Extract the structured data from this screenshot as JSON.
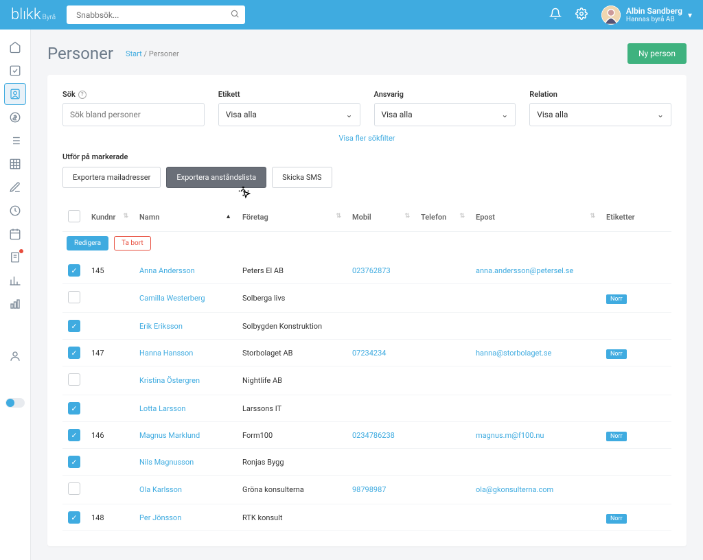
{
  "topbar": {
    "logo_main": "blıkk",
    "logo_sub": "Byrå",
    "search_placeholder": "Snabbsök...",
    "user_name": "Albin Sandberg",
    "user_org": "Hannas byrå AB"
  },
  "page": {
    "title": "Personer",
    "crumb_start": "Start",
    "crumb_sep": " / ",
    "crumb_current": "Personer",
    "new_btn": "Ny person"
  },
  "filters": {
    "sok_label": "Sök",
    "sok_placeholder": "Sök bland personer",
    "etikett_label": "Etikett",
    "etikett_value": "Visa alla",
    "ansvarig_label": "Ansvarig",
    "ansvarig_value": "Visa alla",
    "relation_label": "Relation",
    "relation_value": "Visa alla",
    "more_link": "Visa fler sökfilter"
  },
  "actions": {
    "label": "Utför på markerade",
    "export_email": "Exportera mailadresser",
    "export_anstand": "Exportera anståndslista",
    "send_sms": "Skicka SMS"
  },
  "row_actions": {
    "edit": "Redigera",
    "delete": "Ta bort"
  },
  "columns": {
    "kundnr": "Kundnr",
    "namn": "Namn",
    "foretag": "Företag",
    "mobil": "Mobil",
    "telefon": "Telefon",
    "epost": "Epost",
    "etiketter": "Etiketter"
  },
  "rows": [
    {
      "checked": true,
      "kundnr": "145",
      "namn": "Anna Andersson",
      "foretag": "Peters El AB",
      "mobil": "023762873",
      "telefon": "",
      "epost": "anna.andersson@petersel.se",
      "etikett": ""
    },
    {
      "checked": false,
      "kundnr": "",
      "namn": "Camilla Westerberg",
      "foretag": "Solberga livs",
      "mobil": "",
      "telefon": "",
      "epost": "",
      "etikett": "Norr"
    },
    {
      "checked": true,
      "kundnr": "",
      "namn": "Erik Eriksson",
      "foretag": "Solbygden Konstruktion",
      "mobil": "",
      "telefon": "",
      "epost": "",
      "etikett": ""
    },
    {
      "checked": true,
      "kundnr": "147",
      "namn": "Hanna Hansson",
      "foretag": "Storbolaget AB",
      "mobil": "07234234",
      "telefon": "",
      "epost": "hanna@storbolaget.se",
      "etikett": "Norr"
    },
    {
      "checked": false,
      "kundnr": "",
      "namn": "Kristina Östergren",
      "foretag": "Nightlife AB",
      "mobil": "",
      "telefon": "",
      "epost": "",
      "etikett": ""
    },
    {
      "checked": true,
      "kundnr": "",
      "namn": "Lotta Larsson",
      "foretag": "Larssons IT",
      "mobil": "",
      "telefon": "",
      "epost": "",
      "etikett": ""
    },
    {
      "checked": true,
      "kundnr": "146",
      "namn": "Magnus Marklund",
      "foretag": "Form100",
      "mobil": "0234786238",
      "telefon": "",
      "epost": "magnus.m@f100.nu",
      "etikett": "Norr"
    },
    {
      "checked": true,
      "kundnr": "",
      "namn": "Nils Magnusson",
      "foretag": "Ronjas Bygg",
      "mobil": "",
      "telefon": "",
      "epost": "",
      "etikett": ""
    },
    {
      "checked": false,
      "kundnr": "",
      "namn": "Ola Karlsson",
      "foretag": "Gröna konsulterna",
      "mobil": "98798987",
      "telefon": "",
      "epost": "ola@gkonsulterna.com",
      "etikett": ""
    },
    {
      "checked": true,
      "kundnr": "148",
      "namn": "Per Jönsson",
      "foretag": "RTK konsult",
      "mobil": "",
      "telefon": "",
      "epost": "",
      "etikett": "Norr"
    }
  ]
}
